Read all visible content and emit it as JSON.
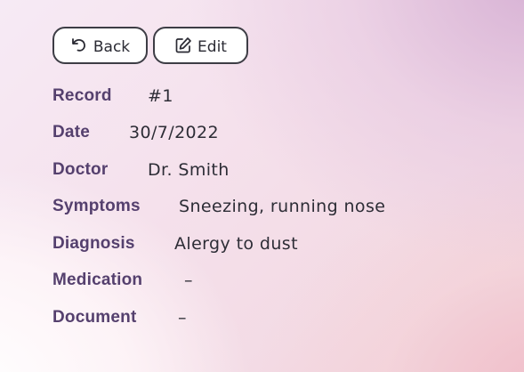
{
  "toolbar": {
    "back_label": "Back",
    "edit_label": "Edit",
    "back_icon": "undo-arrow-icon",
    "edit_icon": "pencil-square-icon"
  },
  "record": {
    "fields": [
      {
        "label": "Record",
        "value": "#1"
      },
      {
        "label": "Date",
        "value": "30/7/2022"
      },
      {
        "label": "Doctor",
        "value": "Dr. Smith"
      },
      {
        "label": "Symptoms",
        "value": "Sneezing, running nose"
      },
      {
        "label": "Diagnosis",
        "value": "Alergy to dust"
      },
      {
        "label": "Medication",
        "value": "–"
      },
      {
        "label": "Document",
        "value": "–"
      }
    ]
  },
  "colors": {
    "label": "#55406e",
    "value": "#2d2d36",
    "button_border": "#3d3d45"
  }
}
